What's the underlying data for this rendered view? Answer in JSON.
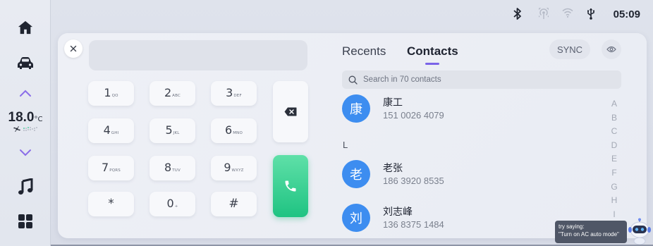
{
  "status_bar": {
    "time": "05:09",
    "icons": [
      "bluetooth-icon",
      "hotspot-icon",
      "wifi-icon",
      "usb-icon"
    ]
  },
  "sidebar": {
    "items": [
      {
        "name": "home",
        "icon": "home-icon"
      },
      {
        "name": "vehicle",
        "icon": "car-icon"
      },
      {
        "name": "temp-up",
        "icon": "chevron-up-icon"
      },
      {
        "name": "temp-down",
        "icon": "chevron-down-icon"
      },
      {
        "name": "music",
        "icon": "music-note-icon"
      },
      {
        "name": "apps",
        "icon": "apps-grid-icon"
      }
    ],
    "climate": {
      "temperature": "18.0",
      "unit": "°C",
      "fan_icon": "fan-icon"
    },
    "accent_color": "#8a6de8"
  },
  "dialer": {
    "display_value": "",
    "keys": [
      {
        "main": "1",
        "sub": "QO"
      },
      {
        "main": "2",
        "sub": "ABC"
      },
      {
        "main": "3",
        "sub": "DEF"
      },
      {
        "main": "4",
        "sub": "GHI"
      },
      {
        "main": "5",
        "sub": "JKL"
      },
      {
        "main": "6",
        "sub": "MNO"
      },
      {
        "main": "7",
        "sub": "PQRS"
      },
      {
        "main": "8",
        "sub": "TUV"
      },
      {
        "main": "9",
        "sub": "WXYZ"
      },
      {
        "main": "*",
        "sub": ""
      },
      {
        "main": "0",
        "sub": "+"
      },
      {
        "main": "#",
        "sub": ""
      }
    ],
    "call_color": "#1fc382"
  },
  "contacts_panel": {
    "tabs": [
      {
        "label": "Recents",
        "active": false
      },
      {
        "label": "Contacts",
        "active": true
      }
    ],
    "sync_label": "SYNC",
    "search_placeholder": "Search in 70 contacts",
    "section_letter": "L",
    "contacts": [
      {
        "avatar": "康",
        "name": "康工",
        "phone": "151 0026 4079"
      },
      {
        "avatar": "老",
        "name": "老张",
        "phone": "186 3920 8535"
      },
      {
        "avatar": "刘",
        "name": "刘志峰",
        "phone": "136 8375 1484"
      }
    ],
    "alpha_index": [
      "A",
      "B",
      "C",
      "D",
      "E",
      "F",
      "G",
      "H",
      "I"
    ],
    "avatar_color": "#3d8df0",
    "tab_indicator_color": "#7a63e8"
  },
  "assistant": {
    "hint_line1": "try saying:",
    "hint_line2": "\"Turn on AC auto mode\""
  }
}
